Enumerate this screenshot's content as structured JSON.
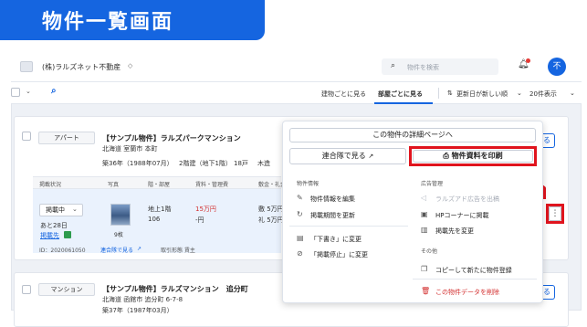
{
  "banner": {
    "title": "物件一覧画面"
  },
  "topbar": {
    "company": "(株)ラルズネット不動産",
    "caret": "◇",
    "search_placeholder": "物件を検索",
    "avatar_initial": "不"
  },
  "toolbar": {
    "view_by_building": "建物ごとに見る",
    "view_by_room": "部屋ごとに見る",
    "sort": "更新日が新しい順",
    "per_page": "20件表示"
  },
  "card1": {
    "type": "アパート",
    "name": "【サンプル物件】ラルズパークマンション",
    "address": "北海道 室蘭市 本町",
    "built": "築36年（1988年07月）",
    "floors": "2階建（地下1階）",
    "units": "18戸",
    "structure": "木造",
    "columns": [
      "掲載状況",
      "写真",
      "階・部屋",
      "賃料・管理費",
      "敷金・礼金"
    ],
    "status": "掲載中",
    "remaining": "あと28日",
    "publish_dest": "掲載先",
    "photo_count": "9枚",
    "floor": "地上1階",
    "room": "106",
    "rent": "15万円",
    "mgmt_fee": "-円",
    "deposit": "敷 5万円",
    "key_money": "礼 5万円",
    "id_text": "ID：2020061050",
    "realestate_link": "連合隊で見る",
    "deal_type": "取引形態 賃主",
    "edit_btn": "る"
  },
  "card2": {
    "type": "マンション",
    "name": "【サンプル物件】ラルズマンション　追分町",
    "address": "北海道 函館市 追分町 6-7-8",
    "built": "築37年（1987年03月）",
    "edit_btn": "る"
  },
  "menu": {
    "detail_page": "この物件の詳細ページへ",
    "view_rengotai": "連合隊で見る",
    "print": "物件資料を印刷",
    "section_info": "物件情報",
    "edit_info": "物件情報を編集",
    "renew_period": "掲載期間を更新",
    "change_draft": "「下書き」に変更",
    "change_stop": "「掲載停止」に変更",
    "section_ads": "広告管理",
    "ad_larzu": "ラルズアド広告を出稿",
    "hp_corner": "HPコーナーに掲載",
    "change_dest": "掲載先を変更",
    "section_other": "その他",
    "copy_register": "コピーして新たに物件登録",
    "delete": "この物件データを削除"
  },
  "colors": {
    "accent": "#1565e0",
    "highlight": "#e0141e",
    "danger": "#d32f2f"
  }
}
